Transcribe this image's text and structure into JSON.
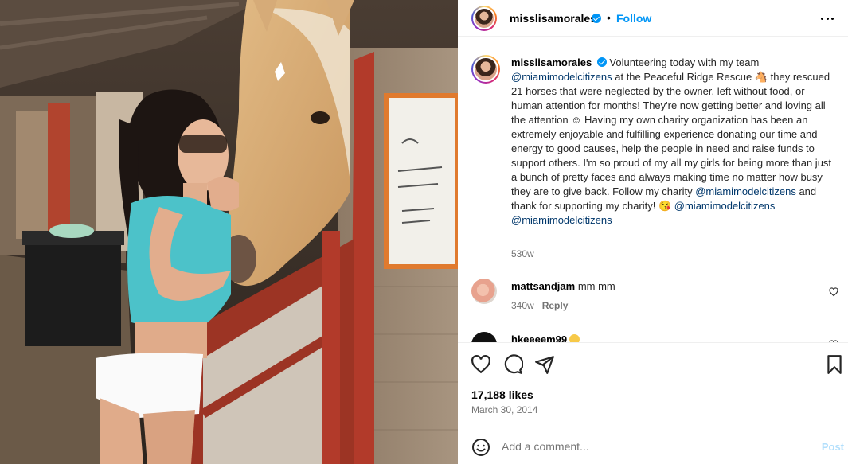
{
  "photo": {
    "alt_icon": "horse-photo"
  },
  "post": {
    "username": "misslisamorales",
    "verified": true,
    "follow_label": "Follow",
    "dot": "•",
    "more_icon": "more-options-icon"
  },
  "caption": {
    "username": "misslisamorales",
    "text_1": " Volunteering today with my team ",
    "mention_1": "@miamimodelcitizens",
    "text_2": " at the Peaceful Ridge Rescue 🐴 they rescued 21 horses that were neglected by the owner, left without food, or human attention for months! They're now getting better and loving all the attention ☺ Having my own charity organization has been an extremely enjoyable and fulfilling experience donating our time and energy to good causes, help the people in need and raise funds to support others. I'm so proud of my all my girls for being more than just a bunch of pretty faces and always making time no matter how busy they are to give back. Follow my charity ",
    "mention_2": "@miamimodelcitizens",
    "text_3": " and thank for supporting my charity! 😘 ",
    "mention_3": "@miamimodelcitizens",
    "text_4": " ",
    "mention_4": "@miamimodelcitizens",
    "time": "530w"
  },
  "comments": [
    {
      "username": "mattsandjam",
      "text": "mm mm",
      "time": "340w",
      "reply_label": "Reply"
    },
    {
      "username": "hkeeeem99",
      "text": ""
    }
  ],
  "actions": {
    "likes": "17,188 likes",
    "date": "March 30, 2014"
  },
  "add_comment": {
    "placeholder": "Add a comment...",
    "post_label": "Post"
  },
  "colors": {
    "accent": "#0095f6",
    "mention": "#00376b",
    "muted": "#737373",
    "post_disabled": "#b2dffc"
  }
}
